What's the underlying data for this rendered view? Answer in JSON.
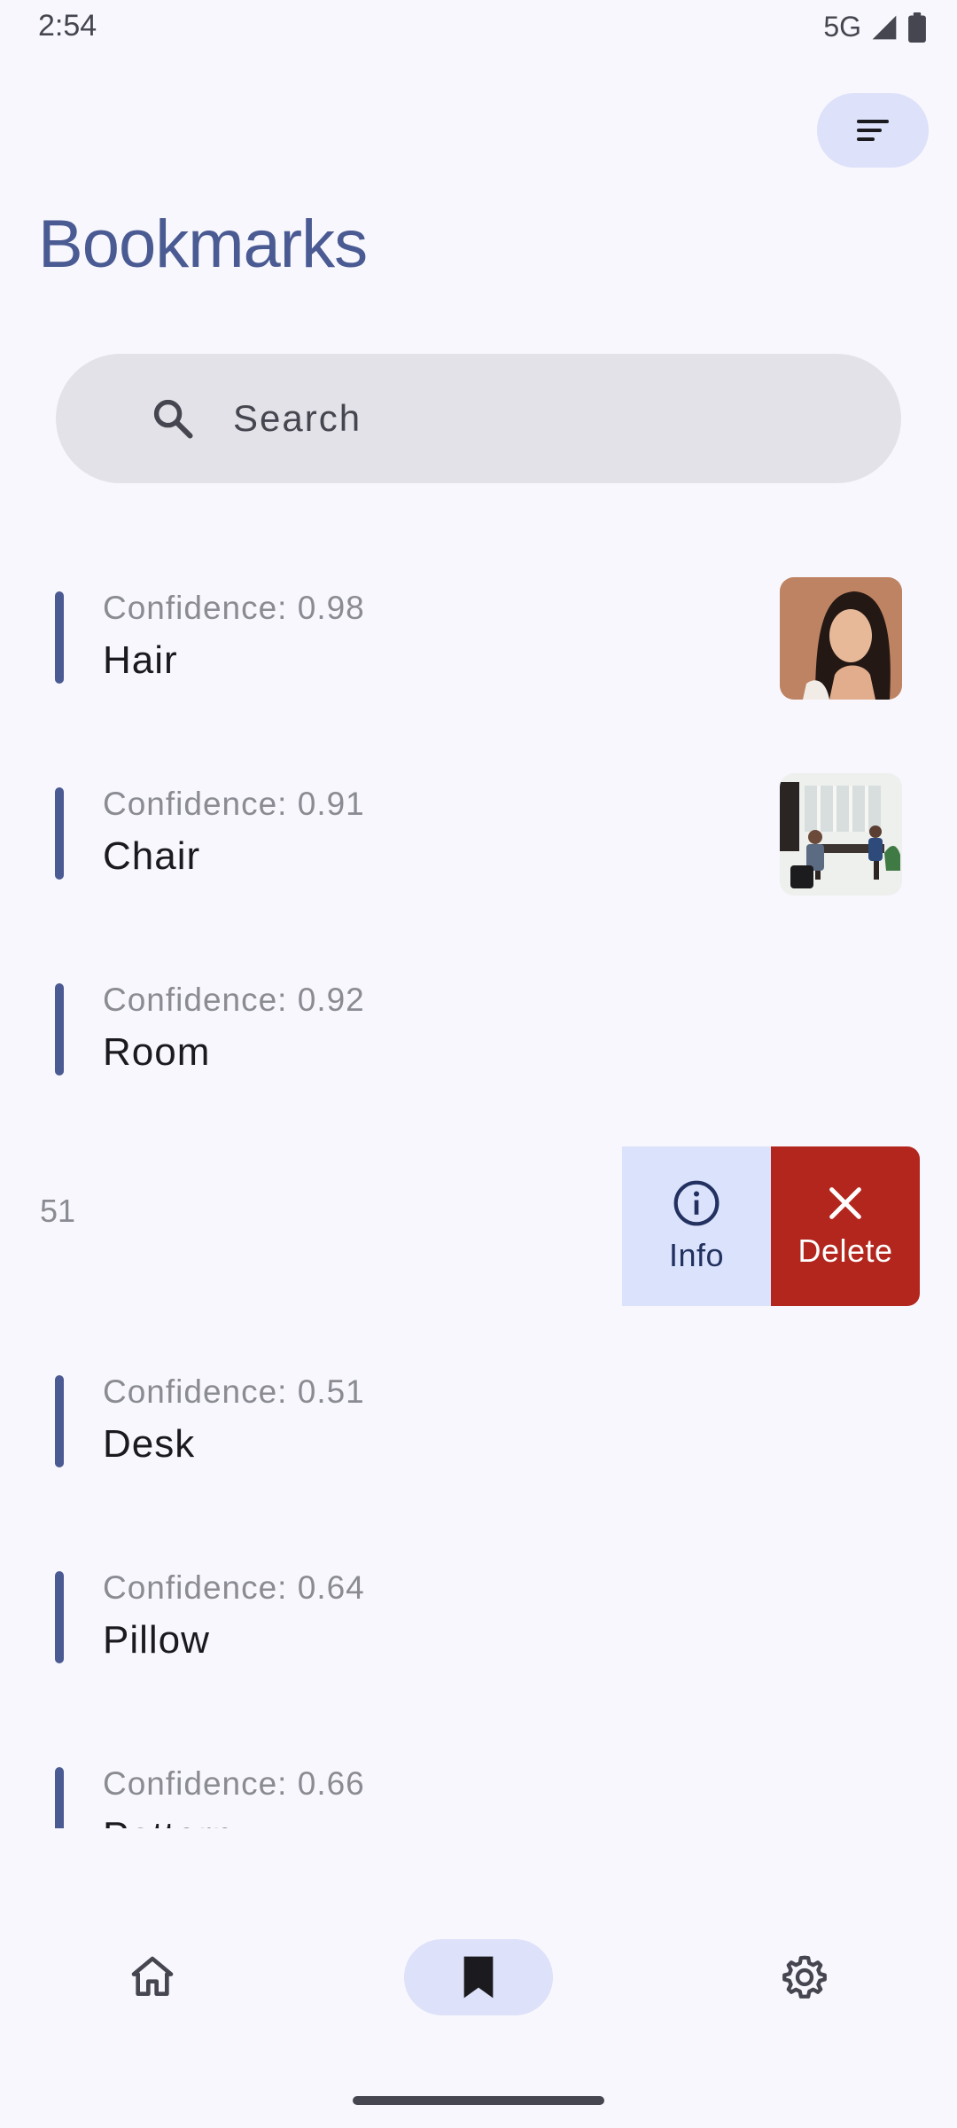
{
  "status_bar": {
    "time": "2:54",
    "network": "5G"
  },
  "header": {
    "title": "Bookmarks",
    "sort_icon": "sort-icon"
  },
  "search": {
    "placeholder": "Search"
  },
  "items": [
    {
      "confidence": "Confidence: 0.98",
      "label": "Hair",
      "thumbnail": "portrait-photo"
    },
    {
      "confidence": "Confidence: 0.91",
      "label": "Chair",
      "thumbnail": "office-photo"
    },
    {
      "confidence": "Confidence: 0.92",
      "label": "Room"
    },
    {
      "confidence": "Confidence: 0.51",
      "label": "Desk"
    },
    {
      "confidence": "Confidence: 0.64",
      "label": "Pillow"
    },
    {
      "confidence": "Confidence: 0.66",
      "label": "Pattern"
    }
  ],
  "swipe_row": {
    "value": "51",
    "info_label": "Info",
    "delete_label": "Delete"
  },
  "bottom_nav": [
    {
      "icon": "home-icon"
    },
    {
      "icon": "bookmark-icon",
      "selected": true
    },
    {
      "icon": "settings-icon"
    }
  ],
  "colors": {
    "accent": "#4a5a92",
    "delete": "#b3261e",
    "info_bg": "#dae2fc",
    "background": "#f8f7fd"
  }
}
